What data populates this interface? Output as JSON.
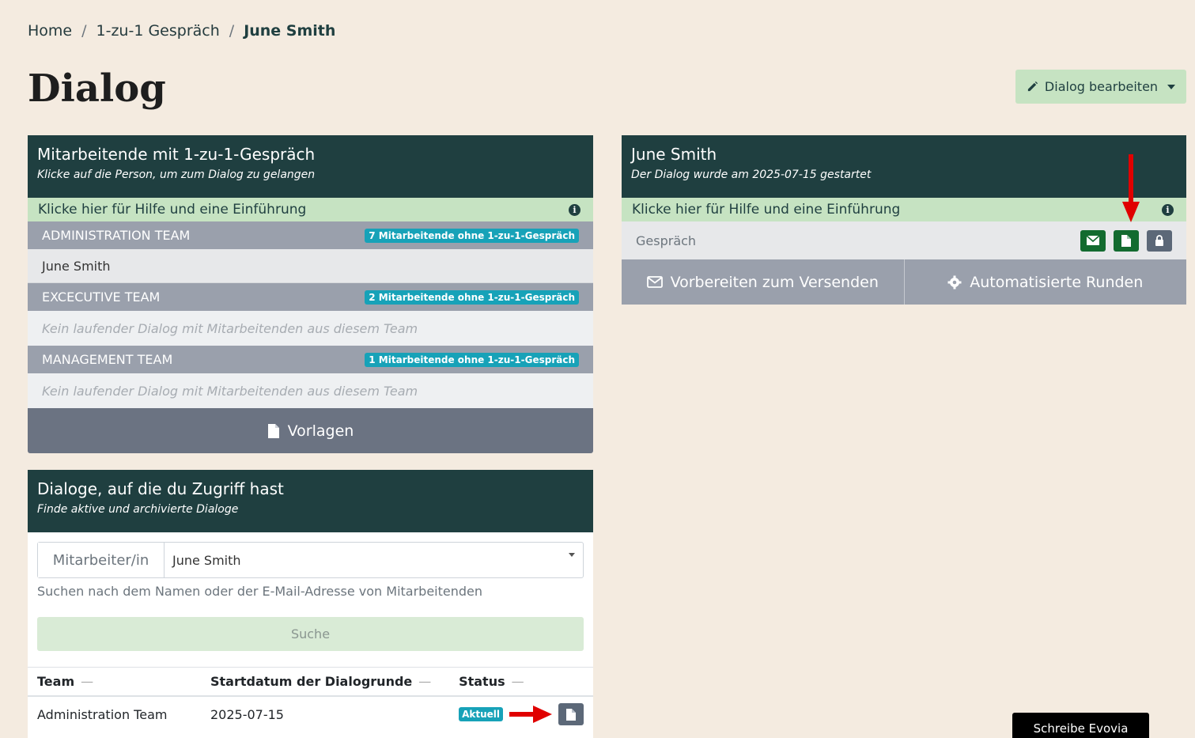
{
  "breadcrumb": {
    "home": "Home",
    "section": "1-zu-1 Gespräch",
    "current": "June Smith",
    "separator": "/"
  },
  "page": {
    "title": "Dialog",
    "edit_label": "Dialog bearbeiten"
  },
  "left_panel": {
    "title": "Mitarbeitende mit 1-zu-1-Gespräch",
    "subtitle": "Klicke auf die Person, um zum Dialog zu gelangen",
    "help": "Klicke hier für Hilfe und eine Einführung",
    "teams": [
      {
        "name": "ADMINISTRATION TEAM",
        "badge": "7 Mitarbeitende ohne 1-zu-1-Gespräch",
        "person": "June Smith"
      },
      {
        "name": "EXCECUTIVE TEAM",
        "badge": "2 Mitarbeitende ohne 1-zu-1-Gespräch",
        "empty": "Kein laufender Dialog mit Mitarbeitenden aus diesem Team"
      },
      {
        "name": "MANAGEMENT TEAM",
        "badge": "1 Mitarbeitende ohne 1-zu-1-Gespräch",
        "empty": "Kein laufender Dialog mit Mitarbeitenden aus diesem Team"
      }
    ],
    "templates_label": "Vorlagen"
  },
  "right_panel": {
    "title": "June Smith",
    "subtitle": "Der Dialog wurde am 2025-07-15 gestartet",
    "help": "Klicke hier für Hilfe und eine Einführung",
    "conversation_label": "Gespräch",
    "prepare_label": "Vorbereiten zum Versenden",
    "auto_label": "Automatisierte Runden"
  },
  "access_panel": {
    "title": "Dialoge, auf die du Zugriff hast",
    "subtitle": "Finde aktive und archivierte Dialoge",
    "employee_label": "Mitarbeiter/in",
    "employee_value": "June Smith",
    "hint": "Suchen nach dem Namen oder der E-Mail-Adresse von Mitarbeitenden",
    "search_label": "Suche",
    "columns": [
      "Team",
      "Startdatum der Dialogrunde",
      "Status"
    ],
    "rows": [
      {
        "team": "Administration Team",
        "start": "2025-07-15",
        "status": "Aktuell"
      }
    ]
  },
  "chat": {
    "label": "Schreibe Evovia"
  },
  "colors": {
    "header": "#1f3f40",
    "help": "#c6e3c2",
    "team": "#9aa0ac",
    "badge": "#17a2b8",
    "accent_red": "#e00000"
  }
}
